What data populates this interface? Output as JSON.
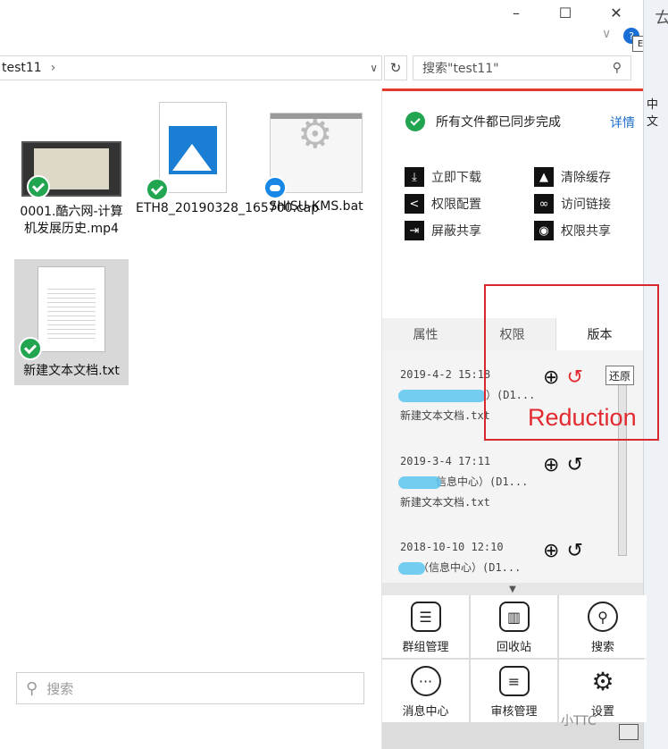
{
  "window": {
    "minimize": "–",
    "maximize": "☐",
    "close": "✕",
    "help": "?",
    "e_badge": "E",
    "side_text": "中文",
    "side_char": "ㄊ"
  },
  "address": {
    "path": "test11",
    "sep": "›",
    "dropdown": "∨",
    "refresh": "↻"
  },
  "search": {
    "placeholder": "搜索\"test11\"",
    "icon": "search-icon"
  },
  "files": [
    {
      "name": "0001.酷六网-计算机发展历史.mp4",
      "status": "synced"
    },
    {
      "name": "ETH8_20190328_165700.cap",
      "status": "synced"
    },
    {
      "name": "SHISU-KMS.bat",
      "status": "cloud"
    },
    {
      "name": "新建文本文档.txt",
      "status": "synced"
    }
  ],
  "bottom_search": {
    "placeholder": "搜索"
  },
  "panel": {
    "sync_status": "所有文件都已同步完成",
    "detail_link": "详情",
    "actions": [
      {
        "label": "立即下载",
        "icon": "download-icon"
      },
      {
        "label": "清除缓存",
        "icon": "eraser-icon"
      },
      {
        "label": "权限配置",
        "icon": "share-icon"
      },
      {
        "label": "访问链接",
        "icon": "link-icon"
      },
      {
        "label": "屏蔽共享",
        "icon": "block-share-icon"
      },
      {
        "label": "权限共享",
        "icon": "eye-icon"
      }
    ],
    "tabs": [
      "属性",
      "权限",
      "版本"
    ],
    "versions": [
      {
        "date": "2019-4-2 15:18",
        "owner": "）(D1...",
        "file": "新建文本文档.txt"
      },
      {
        "date": "2019-3-4 17:11",
        "owner": "信息中心）(D1...",
        "file": "新建文本文档.txt"
      },
      {
        "date": "2018-10-10 12:10",
        "owner": "（信息中心）(D1...",
        "file": ""
      }
    ],
    "restore_tooltip": "还原",
    "grid": [
      {
        "label": "群组管理",
        "icon": "group-icon"
      },
      {
        "label": "回收站",
        "icon": "trash-icon"
      },
      {
        "label": "搜索",
        "icon": "search-icon"
      },
      {
        "label": "消息中心",
        "icon": "message-icon"
      },
      {
        "label": "审核管理",
        "icon": "audit-icon"
      },
      {
        "label": "设置",
        "icon": "gear-icon"
      }
    ]
  },
  "annotation": {
    "text": "Reduction",
    "color": "#e2292f"
  },
  "watermark": "小TTC"
}
